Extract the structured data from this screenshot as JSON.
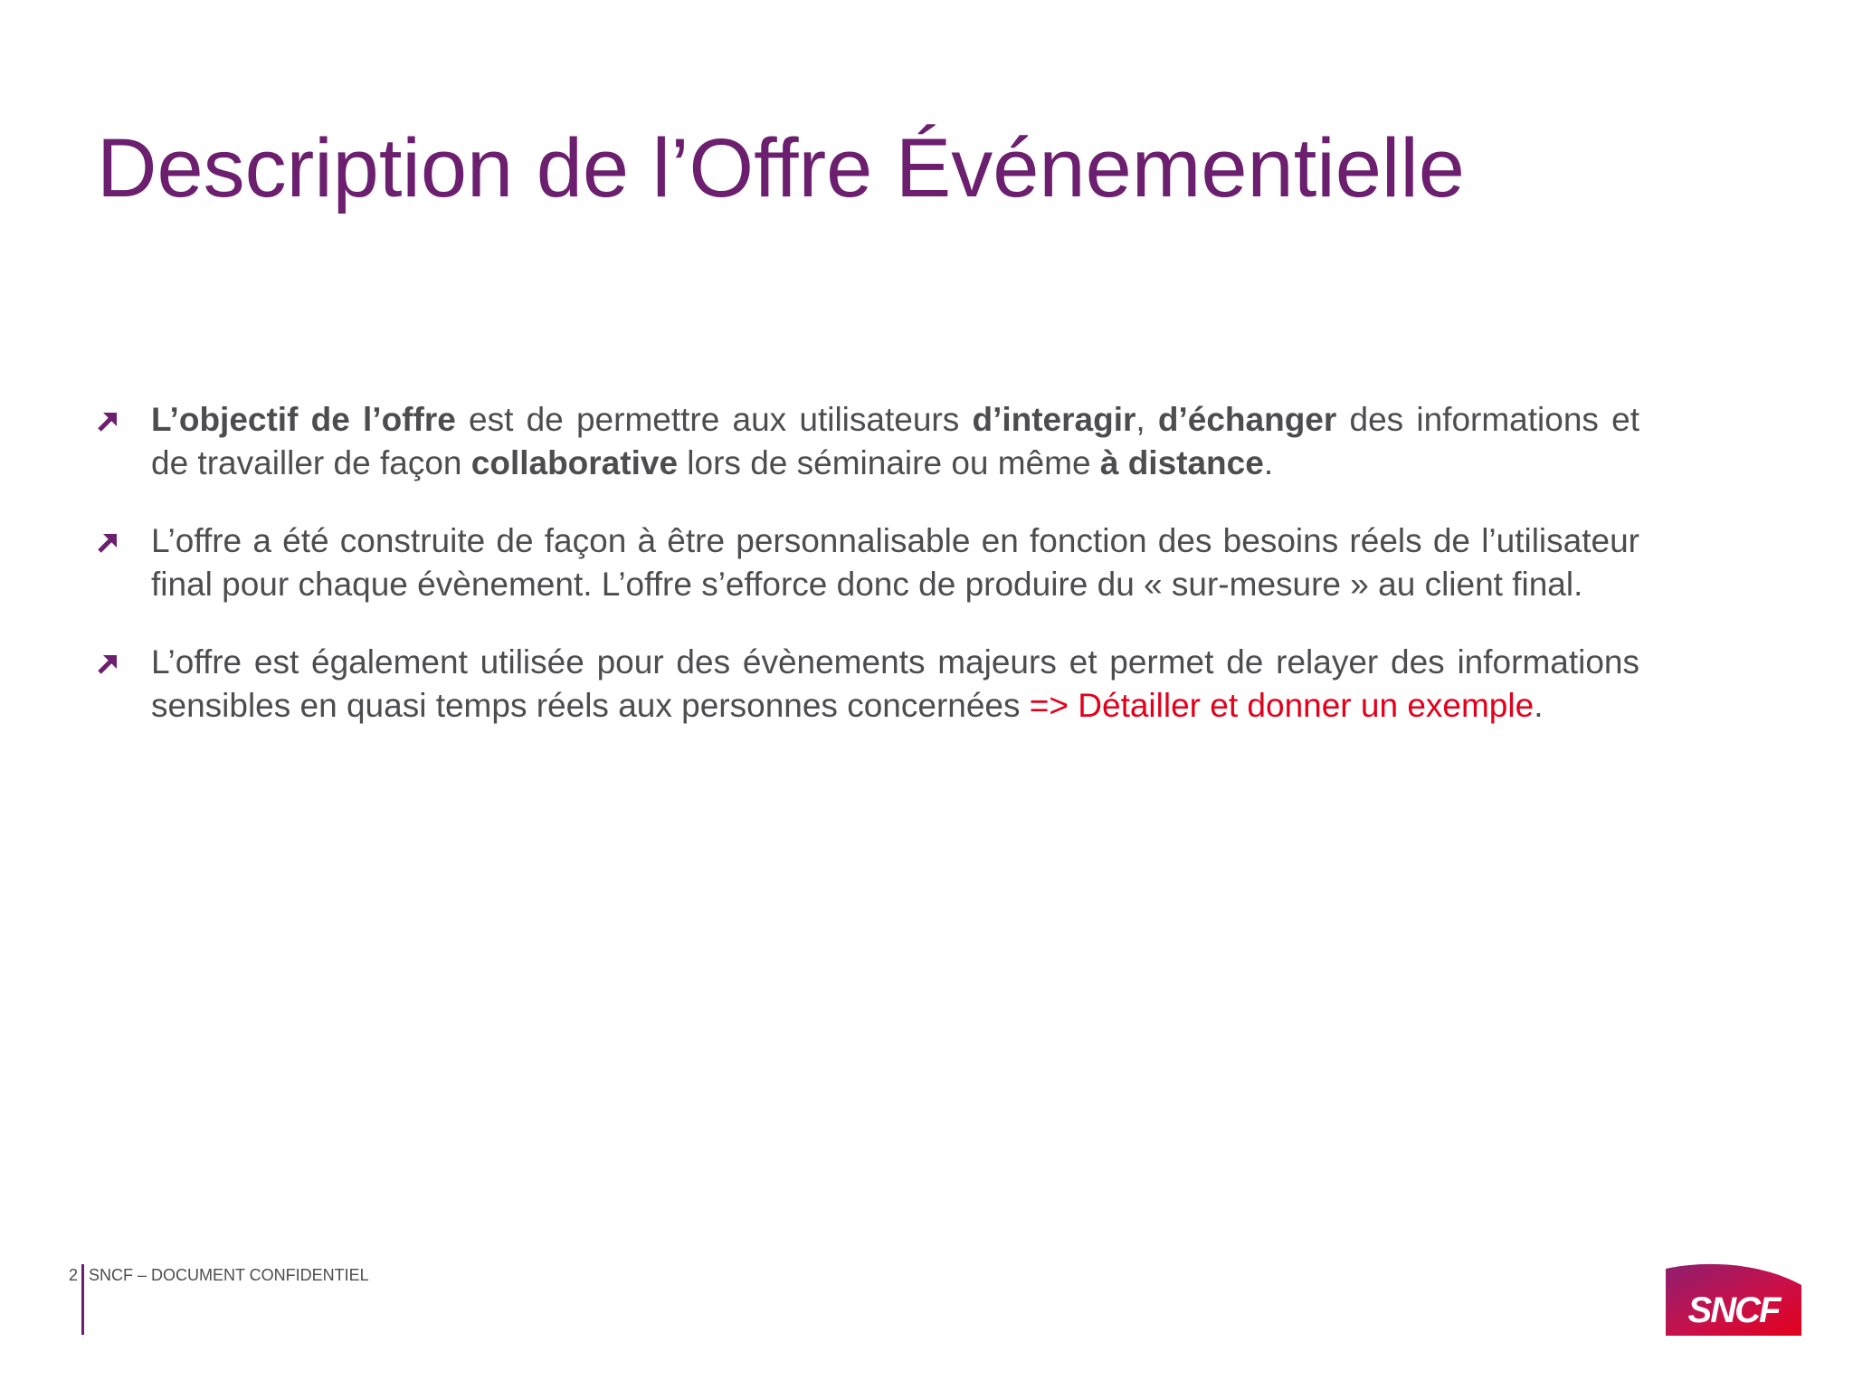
{
  "slide": {
    "title": "Description de l’Offre Événementielle"
  },
  "bullets": [
    {
      "icon": "arrow-up-right-icon",
      "segments": [
        {
          "text": "L’objectif de l’offre",
          "style": "bold"
        },
        {
          "text": " est de permettre aux utilisateurs ",
          "style": "normal"
        },
        {
          "text": "d’interagir",
          "style": "bold"
        },
        {
          "text": ", ",
          "style": "normal"
        },
        {
          "text": "d’échanger",
          "style": "bold"
        },
        {
          "text": " des informations et de travailler de façon ",
          "style": "normal"
        },
        {
          "text": "collaborative",
          "style": "bold"
        },
        {
          "text": " lors de séminaire ou même ",
          "style": "normal"
        },
        {
          "text": "à distance",
          "style": "bold"
        },
        {
          "text": ".",
          "style": "normal"
        }
      ]
    },
    {
      "icon": "arrow-up-right-icon",
      "segments": [
        {
          "text": "L’offre a été construite de façon à être personnalisable en fonction des besoins réels de l’utilisateur final pour chaque évènement. L’offre s’efforce donc de produire du « sur-mesure » au client final.",
          "style": "normal"
        }
      ]
    },
    {
      "icon": "arrow-up-right-icon",
      "segments": [
        {
          "text": "L’offre est également utilisée pour des évènements majeurs et permet de relayer des informations sensibles en quasi temps réels aux personnes concernées ",
          "style": "normal"
        },
        {
          "text": "=> Détailler et donner un exemple",
          "style": "red"
        },
        {
          "text": ".",
          "style": "normal"
        }
      ]
    }
  ],
  "footer": {
    "page_number": "2",
    "label": "SNCF – DOCUMENT CONFIDENTIEL"
  },
  "logo": {
    "icon": "sncf-logo",
    "text": "SNCF"
  },
  "colors": {
    "title": "#6b1f6e",
    "body_text": "#4d4d4f",
    "bullet_icon": "#6b1f6e",
    "highlight_red": "#e3001b",
    "logo_gradient_start": "#9b1f6e",
    "logo_gradient_end": "#e3001b"
  }
}
